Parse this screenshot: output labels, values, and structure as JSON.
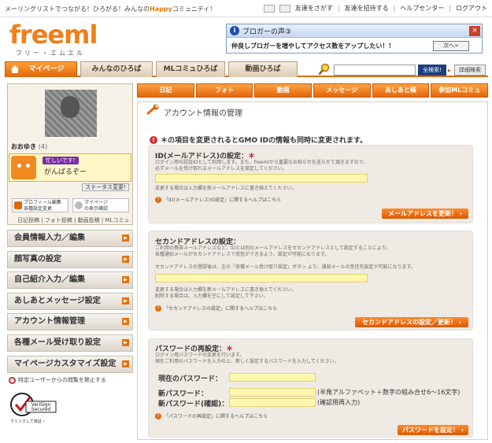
{
  "topbar": {
    "tagline_pre": "メーリングリストでつながる！ひろがる！みんなの",
    "tagline_brand": "Happy",
    "tagline_post": "コミュニティ！",
    "links": [
      "友達をさがす",
      "友達を招待する",
      "ヘルプセンター",
      "ログアウト"
    ]
  },
  "logo": {
    "main": "freeml",
    "sub": "フリー・エムエル"
  },
  "popup": {
    "title": "ブロガーの声③",
    "message": "仲良しブロガーを増やしてアクセス数をアップしたい！！",
    "next": "次へ>",
    "close": "×"
  },
  "nav": {
    "tabs": [
      "マイページ",
      "みんなのひろば",
      "MLコミュひろば",
      "動画ひろば"
    ]
  },
  "search": {
    "button": "全検索!",
    "detail": "詳細検索"
  },
  "subtabs": [
    "日記",
    "フォト",
    "動画",
    "メッセージ",
    "あしあと帳",
    "参加MLコミュ"
  ],
  "profile": {
    "name": "おおゆき",
    "count": "(4)",
    "status_badge": "忙しいです!",
    "status_msg": "がんばるぞー",
    "status_btn": "ステータス変更!",
    "btn1_line1": "プロフィール編集",
    "btn1_line2": "各種設定変更",
    "btn2_line1": "マイページ",
    "btn2_line2": "の表示確認",
    "quicklinks": "日記投稿 | フォト投稿 | 動画投稿 | MLコミュ"
  },
  "menu": [
    "会員情報入力／編集",
    "顔写真の設定",
    "自己紹介入力／編集",
    "あしあとメッセージ設定",
    "アカウント情報管理",
    "各種メール受け取り設定",
    "マイページカスタマイズ設定"
  ],
  "block_note": "特定ユーザーからの閲覧を禁止する",
  "verisign": {
    "line1": "VeriSign",
    "line2": "Secured",
    "caption": "クリックして検証 ›"
  },
  "main": {
    "title": "アカウント情報の管理",
    "notice": "＊の項目を変更されるとGMO IDの情報も同時に変更されます。",
    "id": {
      "heading": "ID(メールアドレス)の設定：",
      "desc1": "ログイン用の認証IDとして利用します。また、freemlから重要なお知らせを送らせて頂きますので、",
      "desc2": "必ずメールを受け取れるメールアドレスを設定してください。",
      "desc3": "変更する場合は入力欄を新メールアドレスに書き換えてください。",
      "help": "「ID(メールアドレス)の設定」に関するヘルプはこちら",
      "button": "メールアドレスを更新！"
    },
    "second": {
      "heading": "セカンドアドレスの設定：",
      "desc1": "ご利用の携帯メールアドレスなど、IDとは別のメールアドレスをセカンドアドレスとして設定することにより、",
      "desc2": "各種通知メールがセカンドアドレスで受信ができるよう、設定が可能になります。",
      "desc3": "セカンドアドレスの登録後は、左の「各種メール受け取り設定」ボタン より、通知メールの受信先設定が可能になります。",
      "desc4": "変更する場合は入力欄を新メールアドレスに書き換えてください。",
      "desc5": "削除する場合は、入力欄を空にして設定して下さい。",
      "help": "「セカンドアドレスの設定」に関するヘルプはこちら",
      "button": "セカンドアドレスの設定／更新！"
    },
    "password": {
      "heading": "パスワードの再設定：",
      "desc1": "ログイン用パスワードの変更を行います。",
      "desc2": "現在ご利用のパスワードを入力の上、新しく設定するパスワードを入力してください。",
      "current": "現在のパスワード：",
      "new": "新パスワード：",
      "confirm": "新パスワード(確認)：",
      "new_note": "(半角アルファベット＋数字の組み合せ6〜16文字)",
      "confirm_note": "(確認用再入力)",
      "help": "「パスワードの再設定」に関するヘルプはこちら",
      "button": "パスワードを設定！"
    },
    "required_mark": "＊"
  }
}
